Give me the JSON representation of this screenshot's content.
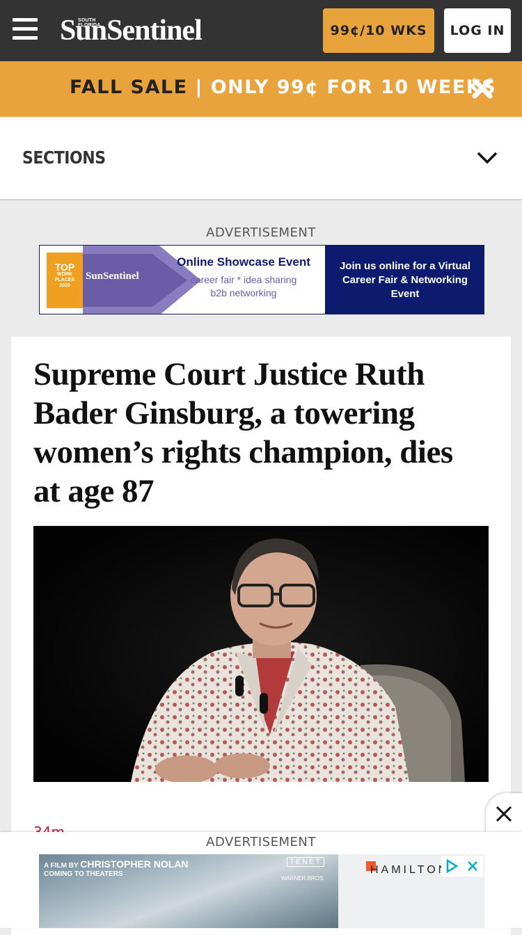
{
  "header": {
    "logo_small": "SOUTH FLORIDA",
    "logo_big": "SunSentinel",
    "subscribe_label": "99¢/10 WKS",
    "login_label": "LOG IN",
    "colors": {
      "bar": "#333333",
      "accent": "#e8a33c"
    }
  },
  "sale_banner": {
    "lead": "FALL SALE",
    "separator": " | ",
    "offer": "ONLY 99¢ FOR 10 WEEKS",
    "close_icon": "close-x-icon"
  },
  "sections": {
    "label": "SECTIONS",
    "icon": "chevron-down-icon"
  },
  "ad_top": {
    "label": "ADVERTISEMENT",
    "badge_top": "TOP",
    "badge_small": "WORK PLACES",
    "badge_year": "2020",
    "logo": "SunSentinel",
    "title": "Online Showcase Event",
    "subtitle_line1": "career fair * idea sharing",
    "subtitle_line2": "b2b networking",
    "right_text": "Join us online for a Virtual Career Fair & Networking Event"
  },
  "article": {
    "headline": "Supreme Court Justice Ruth Bader Ginsburg, a towering women’s rights champion, dies at age 87",
    "timestamp": "34m"
  },
  "ad_bottom": {
    "label": "ADVERTISEMENT",
    "film_prefix": "A FILM BY ",
    "director": "CHRISTOPHER NOLAN",
    "coming": "COMING TO THEATERS",
    "title_mark": "TENET",
    "studio": "WARNER BROS.",
    "brand": "HAMILTON"
  }
}
